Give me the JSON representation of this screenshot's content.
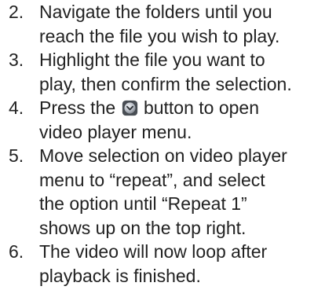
{
  "steps": [
    {
      "number": "2.",
      "lines": [
        "Navigate the folders until you",
        "reach the file you wish to play."
      ]
    },
    {
      "number": "3.",
      "lines": [
        "Highlight the file you want to",
        "play, then confirm the selection."
      ]
    },
    {
      "number": "4.",
      "line1_before_icon": "Press the",
      "line1_after_icon": "button to open",
      "icon": "down-chevron-circle-button-icon",
      "lines": [
        "video player menu."
      ]
    },
    {
      "number": "5.",
      "lines": [
        "Move selection on video player",
        "menu to “repeat”, and select",
        "the option until “Repeat 1”",
        "shows up on the top right."
      ]
    },
    {
      "number": "6.",
      "lines": [
        "The video will now loop after",
        "playback is finished."
      ]
    }
  ],
  "colors": {
    "text": "#222222",
    "icon_ring": "#5a5f66",
    "icon_fill": "#b9bec6"
  }
}
